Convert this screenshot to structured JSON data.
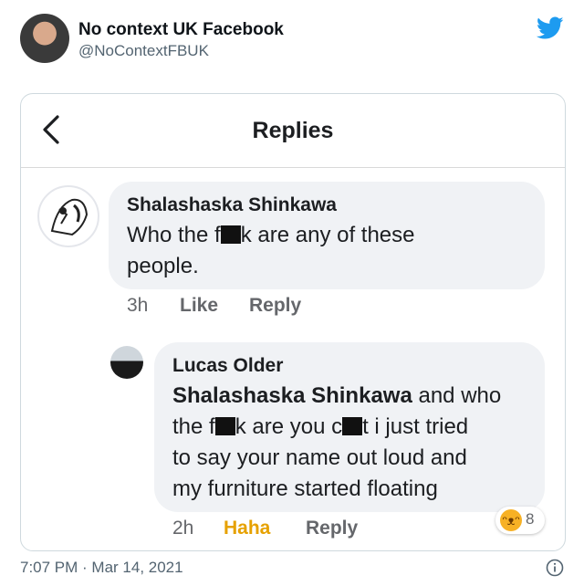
{
  "header": {
    "name": "No context UK Facebook",
    "handle": "@NoContextFBUK"
  },
  "screenshot": {
    "title": "Replies",
    "comment1": {
      "name": "Shalashaska Shinkawa",
      "text_a": "Who the f",
      "text_b": "k are any of these",
      "text_c": "people.",
      "time": "3h",
      "like": "Like",
      "reply": "Reply"
    },
    "comment2": {
      "name": "Lucas Older",
      "mention": "Shalashaska Shinkawa",
      "line1_rest": " and who",
      "line2_a": "the f",
      "line2_b": "k are you c",
      "line2_c": "t i just tried",
      "line3": "to say your name out loud and",
      "line4": "my furniture started floating",
      "time": "2h",
      "reaction_label": "Haha",
      "reply": "Reply",
      "reaction_count": "8"
    }
  },
  "footer": {
    "timestamp": "7:07 PM · Mar 14, 2021"
  },
  "colors": {
    "twitter_blue": "#1d9bf0",
    "haha_yellow": "#e6a100",
    "bubble_gray": "#f0f2f5"
  },
  "icons": [
    "twitter-bird-icon",
    "back-chevron-icon",
    "haha-emoji-icon",
    "info-icon"
  ]
}
